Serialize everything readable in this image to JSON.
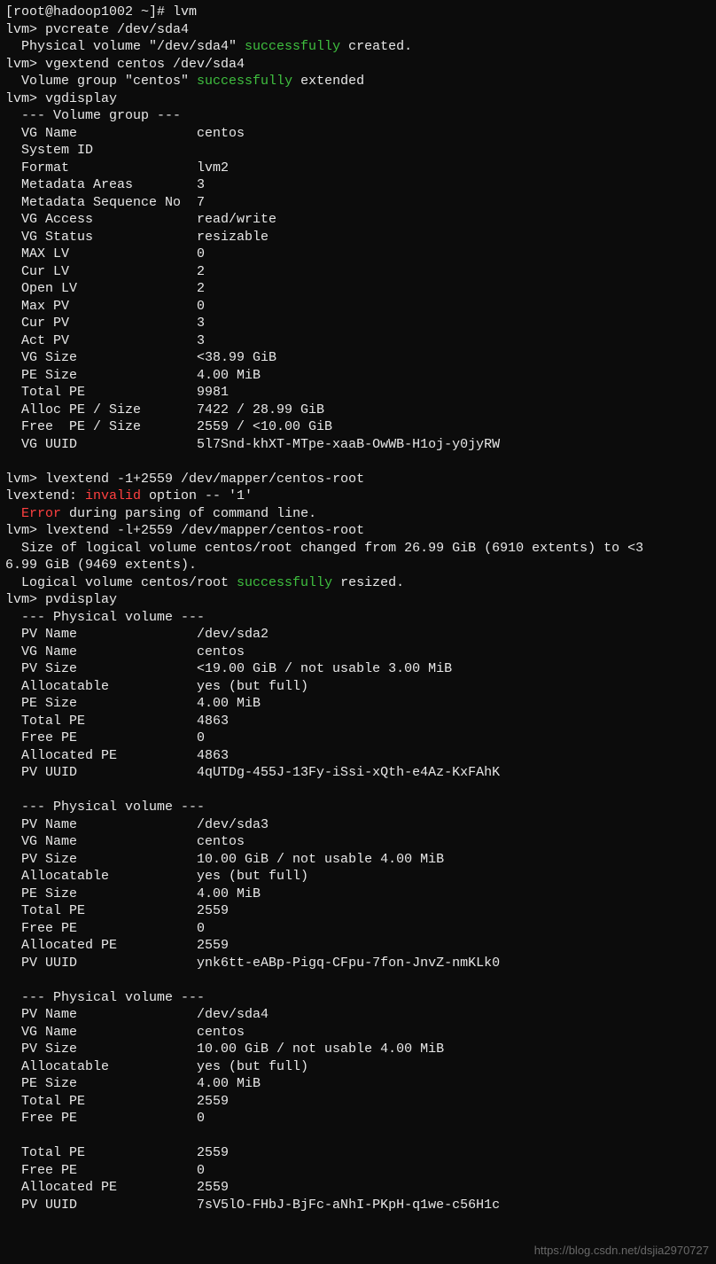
{
  "shell_prompt": "[root@hadoop1002 ~]# ",
  "lvm_prompt": "lvm> ",
  "cmds": {
    "lvm": "lvm",
    "pvcreate": "pvcreate /dev/sda4",
    "vgextend": "vgextend centos /dev/sda4",
    "vgdisplay": "vgdisplay",
    "lvextend_bad": "lvextend -1+2559 /dev/mapper/centos-root",
    "lvextend_ok": "lvextend -l+2559 /dev/mapper/centos-root",
    "pvdisplay": "pvdisplay"
  },
  "msgs": {
    "pvcreate_pre": "  Physical volume \"/dev/sda4\" ",
    "success_word": "successfully",
    "pvcreate_post": " created.",
    "vgextend_pre": "  Volume group \"centos\" ",
    "vgextend_post": " extended",
    "vg_header": "  --- Volume group ---",
    "vg": {
      "name": "  VG Name               centos",
      "sysid": "  System ID",
      "format": "  Format                lvm2",
      "md_areas": "  Metadata Areas        3",
      "md_seq": "  Metadata Sequence No  7",
      "access": "  VG Access             read/write",
      "status": "  VG Status             resizable",
      "max_lv": "  MAX LV                0",
      "cur_lv": "  Cur LV                2",
      "open_lv": "  Open LV               2",
      "max_pv": "  Max PV                0",
      "cur_pv": "  Cur PV                3",
      "act_pv": "  Act PV                3",
      "vg_size": "  VG Size               <38.99 GiB",
      "pe_size": "  PE Size               4.00 MiB",
      "total_pe": "  Total PE              9981",
      "alloc": "  Alloc PE / Size       7422 / 28.99 GiB",
      "free": "  Free  PE / Size       2559 / <10.00 GiB",
      "uuid": "  VG UUID               5l7Snd-khXT-MTpe-xaaB-OwWB-H1oj-y0jyRW"
    },
    "lvextend_err_pre": "lvextend: ",
    "invalid_word": "invalid",
    "lvextend_err_post": " option -- '1'",
    "error_word": "Error",
    "error_line_post": " during parsing of command line.",
    "lvextend_size": "  Size of logical volume centos/root changed from 26.99 GiB (6910 extents) to <3",
    "lvextend_size2": "6.99 GiB (9469 extents).",
    "lvextend_ok_pre": "  Logical volume centos/root ",
    "lvextend_ok_post": " resized.",
    "pv_header": "  --- Physical volume ---",
    "pv1": {
      "name": "  PV Name               /dev/sda2",
      "vg": "  VG Name               centos",
      "size": "  PV Size               <19.00 GiB / not usable 3.00 MiB",
      "alloc": "  Allocatable           yes (but full)",
      "pesize": "  PE Size               4.00 MiB",
      "total": "  Total PE              4863",
      "free": "  Free PE               0",
      "allocpe": "  Allocated PE          4863",
      "uuid": "  PV UUID               4qUTDg-455J-13Fy-iSsi-xQth-e4Az-KxFAhK"
    },
    "pv2": {
      "name": "  PV Name               /dev/sda3",
      "vg": "  VG Name               centos",
      "size": "  PV Size               10.00 GiB / not usable 4.00 MiB",
      "alloc": "  Allocatable           yes (but full)",
      "pesize": "  PE Size               4.00 MiB",
      "total": "  Total PE              2559",
      "free": "  Free PE               0",
      "allocpe": "  Allocated PE          2559",
      "uuid": "  PV UUID               ynk6tt-eABp-Pigq-CFpu-7fon-JnvZ-nmKLk0"
    },
    "pv3": {
      "name": "  PV Name               /dev/sda4",
      "vg": "  VG Name               centos",
      "size": "  PV Size               10.00 GiB / not usable 4.00 MiB",
      "alloc": "  Allocatable           yes (but full)",
      "pesize": "  PE Size               4.00 MiB",
      "total": "  Total PE              2559",
      "free": "  Free PE               0"
    },
    "tail": {
      "total": "  Total PE              2559",
      "free": "  Free PE               0",
      "allocpe": "  Allocated PE          2559",
      "uuid": "  PV UUID               7sV5lO-FHbJ-BjFc-aNhI-PKpH-q1we-c56H1c"
    }
  },
  "watermark": "https://blog.csdn.net/dsjia2970727"
}
